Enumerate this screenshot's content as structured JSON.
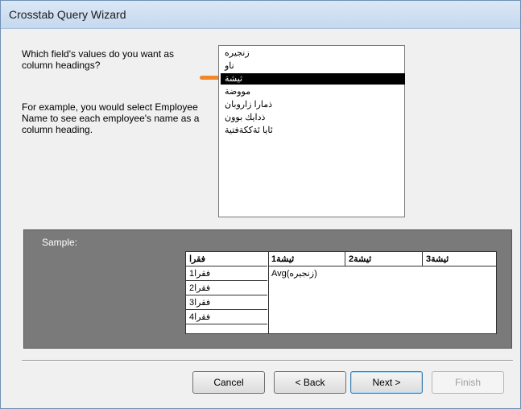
{
  "window": {
    "title": "Crosstab Query Wizard"
  },
  "instructions": {
    "question": "Which field's values do you want as column headings?",
    "example": "For example, you would select Employee Name to see each employee's name as a column heading."
  },
  "fields": [
    "زنجیرە",
    "ناو",
    "ثیشة",
    "مووضة",
    "ذمارا زاروبان",
    "ذدایك بوون",
    "ئایا ئةككةفتية"
  ],
  "selected_field_index": 2,
  "sample": {
    "label": "Sample:",
    "row_header": "فقرا",
    "column_headers": [
      "ثيشة1",
      "ثيشة2",
      "ثيشة3"
    ],
    "row_values": [
      "فقرا1",
      "فقرا2",
      "فقرا3",
      "فقرا4"
    ],
    "value_cell": "Avg(زنجیرە)"
  },
  "buttons": {
    "cancel": "Cancel",
    "back": "< Back",
    "next": "Next >",
    "finish": "Finish"
  },
  "colors": {
    "highlight_arrow": "#f0882a",
    "sample_bg": "#7a7a7a"
  }
}
